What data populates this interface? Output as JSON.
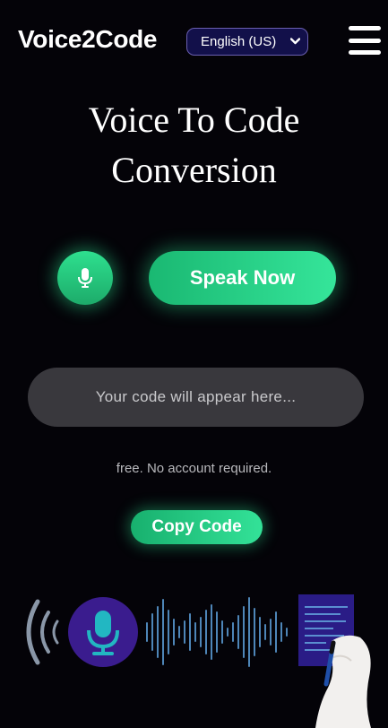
{
  "header": {
    "brand": "Voice2Code",
    "language": "English (US)",
    "menu_icon": "hamburger-menu-icon"
  },
  "hero": {
    "title_line1": "Voice To Code",
    "title_line2": "Conversion"
  },
  "controls": {
    "mic_icon": "microphone-icon",
    "speak_label": "Speak Now"
  },
  "output": {
    "placeholder": "Your code will appear here..."
  },
  "note": "free. No account required.",
  "copy_label": "Copy Code",
  "illustration": {
    "icons": [
      "sound-waves-icon",
      "microphone-icon",
      "audio-waveform",
      "document-icon",
      "hand-with-pen"
    ]
  },
  "colors": {
    "background": "#040308",
    "accent_green": "#2ad888",
    "input_bg": "#39383d",
    "language_bg": "#12104a"
  }
}
